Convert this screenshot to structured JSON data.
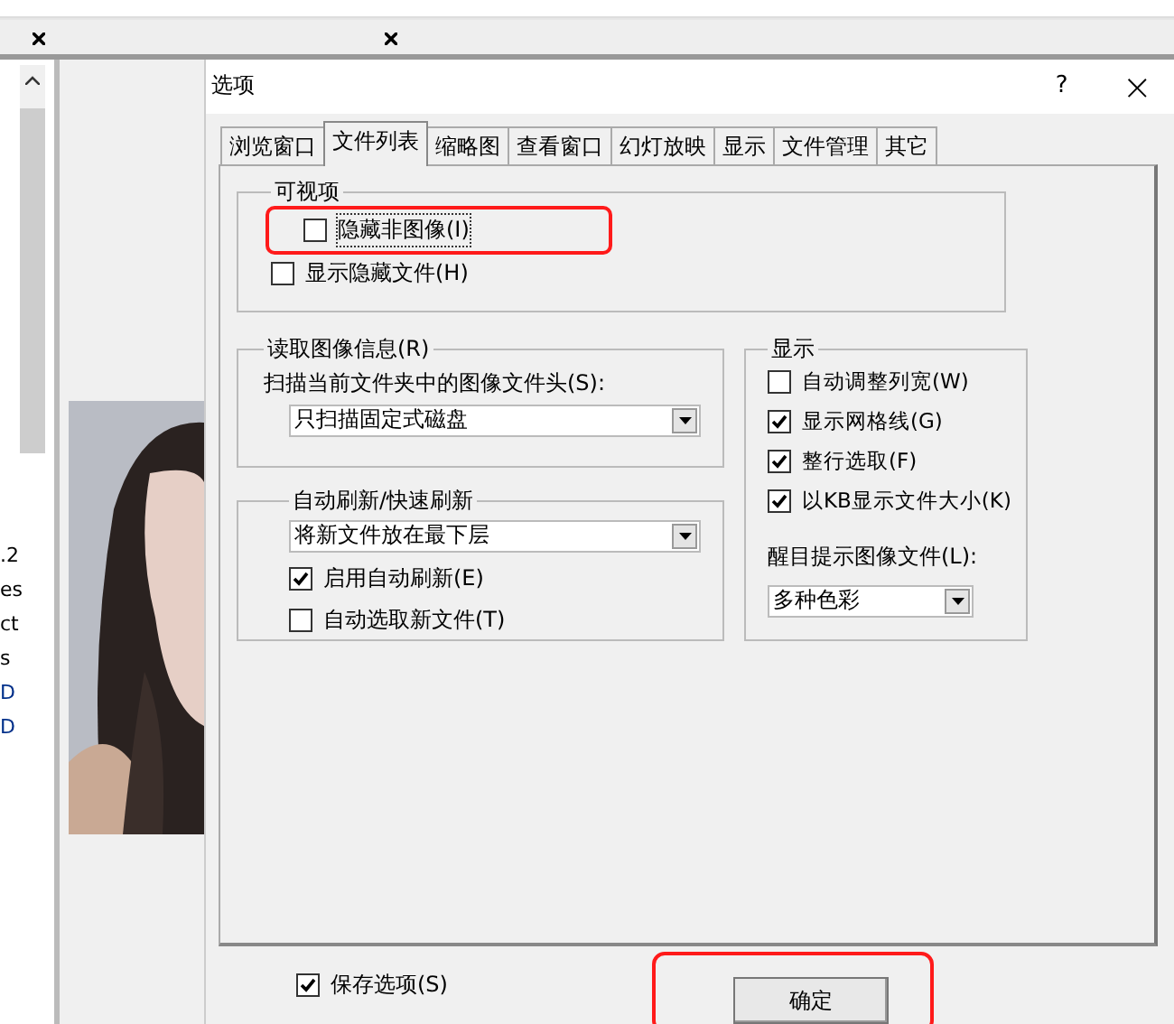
{
  "background": {
    "list_fragments": [
      ".2",
      "es",
      "ct",
      "s",
      "D",
      "D"
    ]
  },
  "dialog": {
    "title": "选项",
    "help": "?",
    "close": "×",
    "tabs": [
      {
        "label": "浏览窗口",
        "selected": false
      },
      {
        "label": "文件列表",
        "selected": true
      },
      {
        "label": "缩略图",
        "selected": false
      },
      {
        "label": "查看窗口",
        "selected": false
      },
      {
        "label": "幻灯放映",
        "selected": false
      },
      {
        "label": "显示",
        "selected": false
      },
      {
        "label": "文件管理",
        "selected": false
      },
      {
        "label": "其它",
        "selected": false
      }
    ],
    "visible_group": {
      "title": "可视项",
      "options": [
        {
          "label": "隐藏非图像(I)",
          "checked": false,
          "highlighted": true
        },
        {
          "label": "显示隐藏文件(H)",
          "checked": false,
          "highlighted": false
        }
      ]
    },
    "read_group": {
      "title": "读取图像信息(R)",
      "label": "扫描当前文件夹中的图像文件头(S):",
      "value": "只扫描固定式磁盘"
    },
    "refresh_group": {
      "title": "自动刷新/快速刷新",
      "value": "将新文件放在最下层",
      "options": [
        {
          "label": "启用自动刷新(E)",
          "checked": true
        },
        {
          "label": "自动选取新文件(T)",
          "checked": false
        }
      ]
    },
    "display_group": {
      "title": "显示",
      "options": [
        {
          "label": "自动调整列宽(W)",
          "checked": false
        },
        {
          "label": "显示网格线(G)",
          "checked": true
        },
        {
          "label": "整行选取(F)",
          "checked": true
        },
        {
          "label": "以KB显示文件大小(K)",
          "checked": true
        }
      ],
      "label": "醒目提示图像文件(L):",
      "value": "多种色彩"
    },
    "save_option": {
      "label": "保存选项(S)",
      "checked": true
    },
    "ok_button": {
      "label": "确定",
      "highlighted": true
    }
  }
}
